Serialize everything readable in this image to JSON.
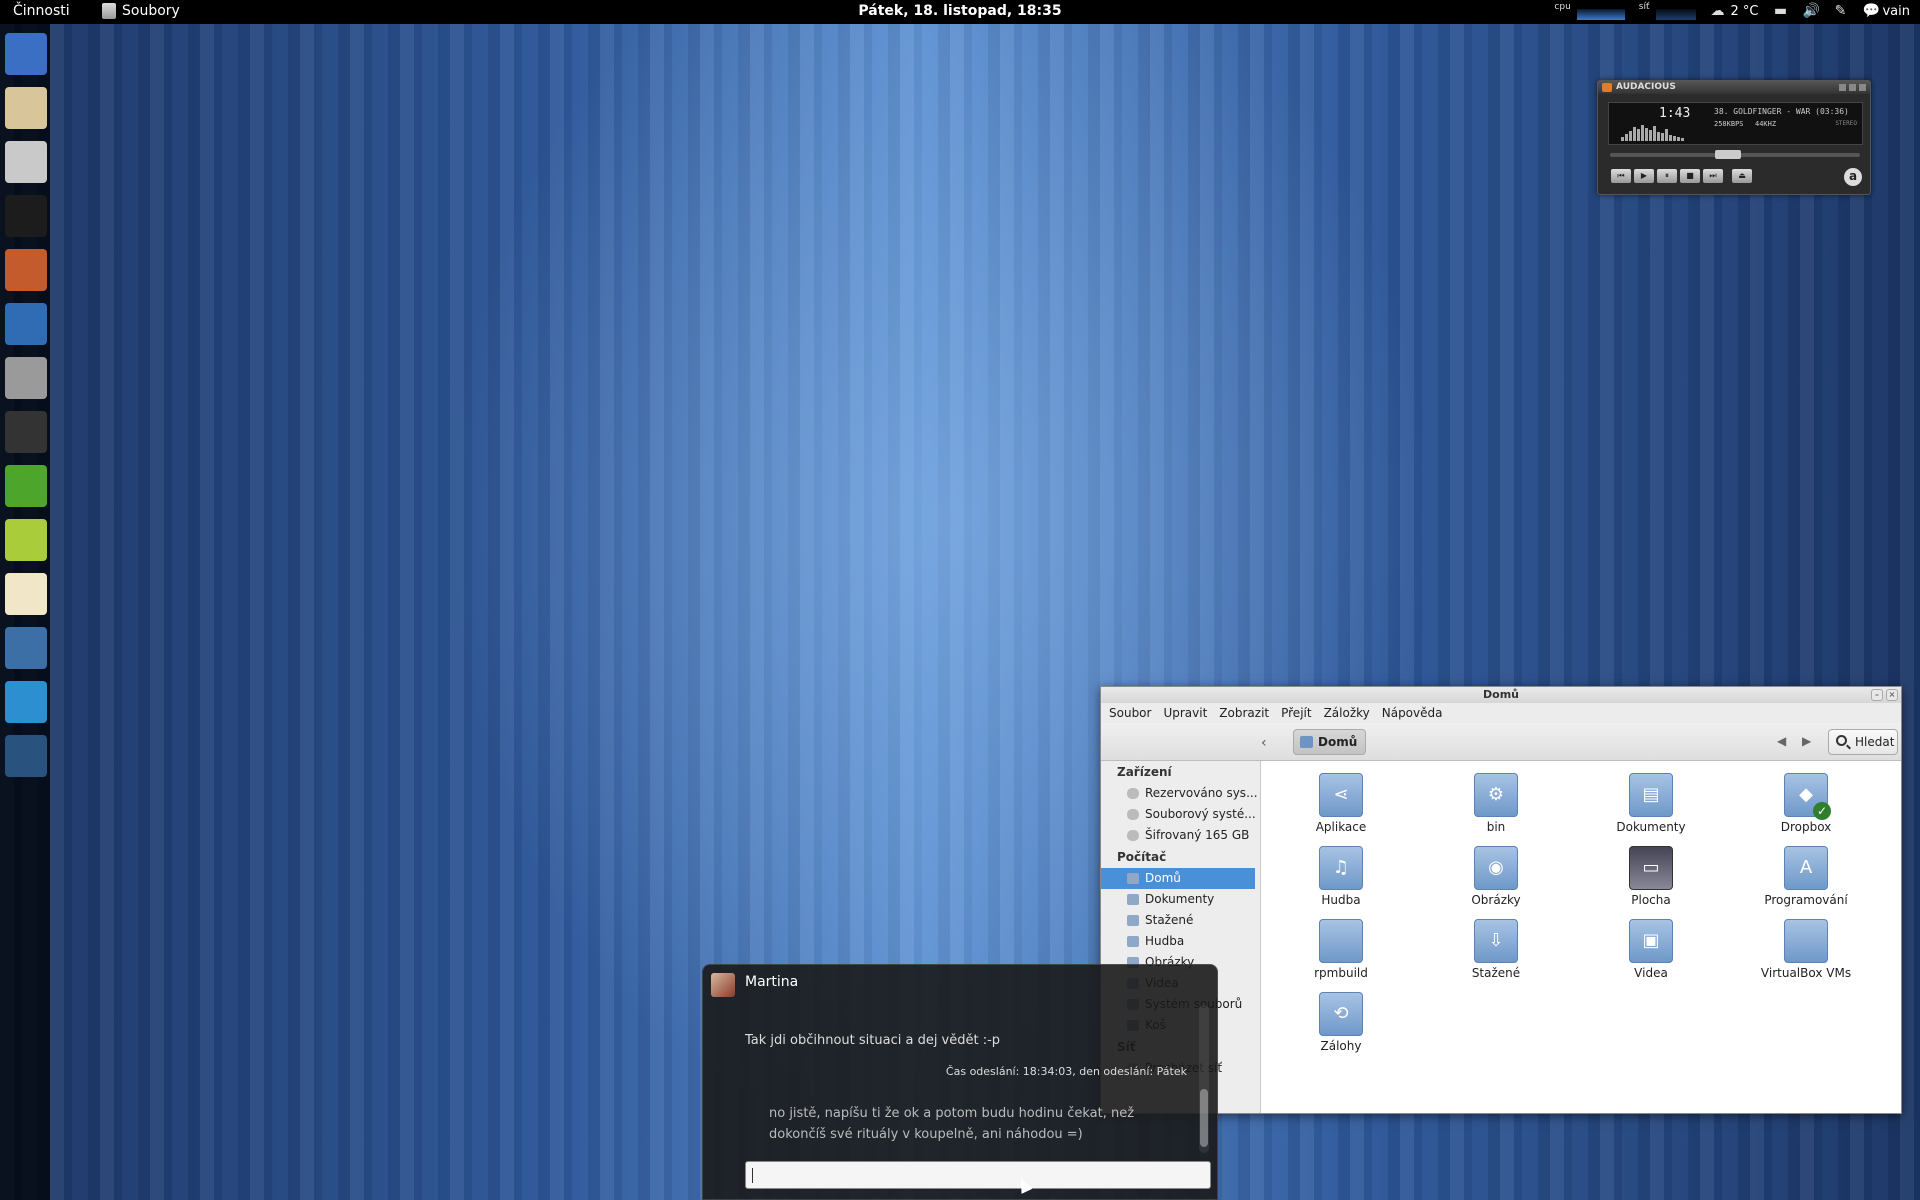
{
  "topbar": {
    "activities": "Činnosti",
    "app_name": "Soubory",
    "clock": "Pátek, 18. listopad, 18:35",
    "cpu_label": "cpu",
    "net_label": "síť",
    "temperature": "2 °C",
    "user": "vain"
  },
  "dash": {
    "items": [
      {
        "name": "chromium",
        "color": "#3a6fc4"
      },
      {
        "name": "mail",
        "color": "#d8c59a"
      },
      {
        "name": "files",
        "color": "#c9c9c9"
      },
      {
        "name": "terminal",
        "color": "#1c1c1c"
      },
      {
        "name": "paint",
        "color": "#c35b2d"
      },
      {
        "name": "writer",
        "color": "#2f6cb3"
      },
      {
        "name": "calculator",
        "color": "#9a9a9a"
      },
      {
        "name": "audacious",
        "color": "#333333"
      },
      {
        "name": "irc",
        "color": "#4da52b"
      },
      {
        "name": "idea",
        "color": "#a8cc3a"
      },
      {
        "name": "notes",
        "color": "#f1e7c8"
      },
      {
        "name": "settings",
        "color": "#3b6fa6"
      },
      {
        "name": "monitor",
        "color": "#2b8fd0"
      },
      {
        "name": "video",
        "color": "#29527f"
      }
    ]
  },
  "audacious": {
    "title": "AUDACIOUS",
    "time": "1:43",
    "track": "38. GOLDFINGER - WAR (03:36)",
    "kbps": "258KBPS",
    "khz": "44KHZ",
    "stereo": "STEREO",
    "buttons": [
      "⏮",
      "▶",
      "⏸",
      "■",
      "⏭",
      "⏏"
    ],
    "logo": "a"
  },
  "nautilus": {
    "title": "Domů",
    "menu": [
      "Soubor",
      "Upravit",
      "Zobrazit",
      "Přejít",
      "Záložky",
      "Nápověda"
    ],
    "breadcrumb": "Domů",
    "search": "Hledat",
    "sidebar": {
      "devices_header": "Zařízení",
      "devices": [
        "Rezervováno sys...",
        "Souborový systé...",
        "Šifrovaný 165 GB"
      ],
      "computer_header": "Počítač",
      "computer": [
        "Domů",
        "Dokumenty",
        "Stažené",
        "Hudba",
        "Obrázky",
        "Videa",
        "Systém souborů",
        "Koš"
      ],
      "network_header": "Síť",
      "network": [
        "Procházet síť"
      ]
    },
    "files": [
      {
        "label": "Aplikace",
        "glyph": "⋖"
      },
      {
        "label": "bin",
        "glyph": "⚙"
      },
      {
        "label": "Dokumenty",
        "glyph": "▤"
      },
      {
        "label": "Dropbox",
        "glyph": "◆"
      },
      {
        "label": "Hudba",
        "glyph": "♫"
      },
      {
        "label": "Obrázky",
        "glyph": "◉"
      },
      {
        "label": "Plocha",
        "glyph": "▭"
      },
      {
        "label": "Programování",
        "glyph": "A"
      },
      {
        "label": "rpmbuild",
        "glyph": ""
      },
      {
        "label": "Stažené",
        "glyph": "⇩"
      },
      {
        "label": "Videa",
        "glyph": "▣"
      },
      {
        "label": "VirtualBox VMs",
        "glyph": ""
      },
      {
        "label": "Zálohy",
        "glyph": "⟲"
      }
    ]
  },
  "chat": {
    "contact": "Martina",
    "message1": "Tak jdi občihnout situaci a dej vědět :-p",
    "timestamp": "Čas odeslání: 18:34:03, den odeslání: Pátek",
    "message2": "no jistě, napíšu ti že ok a potom budu hodinu čekat, než dokončíš své rituály v koupelně, ani náhodou =)",
    "input_value": ""
  }
}
